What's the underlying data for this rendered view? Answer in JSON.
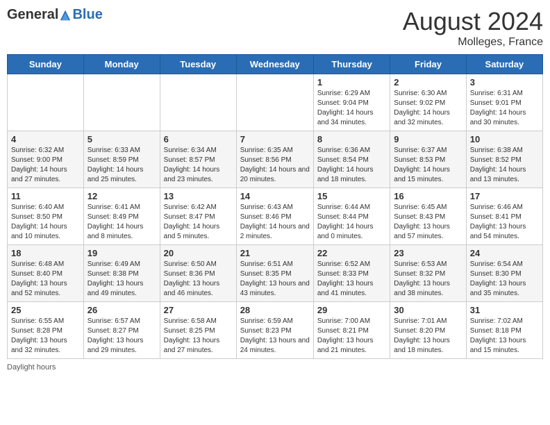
{
  "header": {
    "logo": {
      "general": "General",
      "blue": "Blue"
    },
    "title": "August 2024",
    "subtitle": "Molleges, France"
  },
  "days_of_week": [
    "Sunday",
    "Monday",
    "Tuesday",
    "Wednesday",
    "Thursday",
    "Friday",
    "Saturday"
  ],
  "weeks": [
    [
      {
        "day": "",
        "sunrise": "",
        "sunset": "",
        "daylight": ""
      },
      {
        "day": "",
        "sunrise": "",
        "sunset": "",
        "daylight": ""
      },
      {
        "day": "",
        "sunrise": "",
        "sunset": "",
        "daylight": ""
      },
      {
        "day": "",
        "sunrise": "",
        "sunset": "",
        "daylight": ""
      },
      {
        "day": "1",
        "sunrise": "Sunrise: 6:29 AM",
        "sunset": "Sunset: 9:04 PM",
        "daylight": "Daylight: 14 hours and 34 minutes."
      },
      {
        "day": "2",
        "sunrise": "Sunrise: 6:30 AM",
        "sunset": "Sunset: 9:02 PM",
        "daylight": "Daylight: 14 hours and 32 minutes."
      },
      {
        "day": "3",
        "sunrise": "Sunrise: 6:31 AM",
        "sunset": "Sunset: 9:01 PM",
        "daylight": "Daylight: 14 hours and 30 minutes."
      }
    ],
    [
      {
        "day": "4",
        "sunrise": "Sunrise: 6:32 AM",
        "sunset": "Sunset: 9:00 PM",
        "daylight": "Daylight: 14 hours and 27 minutes."
      },
      {
        "day": "5",
        "sunrise": "Sunrise: 6:33 AM",
        "sunset": "Sunset: 8:59 PM",
        "daylight": "Daylight: 14 hours and 25 minutes."
      },
      {
        "day": "6",
        "sunrise": "Sunrise: 6:34 AM",
        "sunset": "Sunset: 8:57 PM",
        "daylight": "Daylight: 14 hours and 23 minutes."
      },
      {
        "day": "7",
        "sunrise": "Sunrise: 6:35 AM",
        "sunset": "Sunset: 8:56 PM",
        "daylight": "Daylight: 14 hours and 20 minutes."
      },
      {
        "day": "8",
        "sunrise": "Sunrise: 6:36 AM",
        "sunset": "Sunset: 8:54 PM",
        "daylight": "Daylight: 14 hours and 18 minutes."
      },
      {
        "day": "9",
        "sunrise": "Sunrise: 6:37 AM",
        "sunset": "Sunset: 8:53 PM",
        "daylight": "Daylight: 14 hours and 15 minutes."
      },
      {
        "day": "10",
        "sunrise": "Sunrise: 6:38 AM",
        "sunset": "Sunset: 8:52 PM",
        "daylight": "Daylight: 14 hours and 13 minutes."
      }
    ],
    [
      {
        "day": "11",
        "sunrise": "Sunrise: 6:40 AM",
        "sunset": "Sunset: 8:50 PM",
        "daylight": "Daylight: 14 hours and 10 minutes."
      },
      {
        "day": "12",
        "sunrise": "Sunrise: 6:41 AM",
        "sunset": "Sunset: 8:49 PM",
        "daylight": "Daylight: 14 hours and 8 minutes."
      },
      {
        "day": "13",
        "sunrise": "Sunrise: 6:42 AM",
        "sunset": "Sunset: 8:47 PM",
        "daylight": "Daylight: 14 hours and 5 minutes."
      },
      {
        "day": "14",
        "sunrise": "Sunrise: 6:43 AM",
        "sunset": "Sunset: 8:46 PM",
        "daylight": "Daylight: 14 hours and 2 minutes."
      },
      {
        "day": "15",
        "sunrise": "Sunrise: 6:44 AM",
        "sunset": "Sunset: 8:44 PM",
        "daylight": "Daylight: 14 hours and 0 minutes."
      },
      {
        "day": "16",
        "sunrise": "Sunrise: 6:45 AM",
        "sunset": "Sunset: 8:43 PM",
        "daylight": "Daylight: 13 hours and 57 minutes."
      },
      {
        "day": "17",
        "sunrise": "Sunrise: 6:46 AM",
        "sunset": "Sunset: 8:41 PM",
        "daylight": "Daylight: 13 hours and 54 minutes."
      }
    ],
    [
      {
        "day": "18",
        "sunrise": "Sunrise: 6:48 AM",
        "sunset": "Sunset: 8:40 PM",
        "daylight": "Daylight: 13 hours and 52 minutes."
      },
      {
        "day": "19",
        "sunrise": "Sunrise: 6:49 AM",
        "sunset": "Sunset: 8:38 PM",
        "daylight": "Daylight: 13 hours and 49 minutes."
      },
      {
        "day": "20",
        "sunrise": "Sunrise: 6:50 AM",
        "sunset": "Sunset: 8:36 PM",
        "daylight": "Daylight: 13 hours and 46 minutes."
      },
      {
        "day": "21",
        "sunrise": "Sunrise: 6:51 AM",
        "sunset": "Sunset: 8:35 PM",
        "daylight": "Daylight: 13 hours and 43 minutes."
      },
      {
        "day": "22",
        "sunrise": "Sunrise: 6:52 AM",
        "sunset": "Sunset: 8:33 PM",
        "daylight": "Daylight: 13 hours and 41 minutes."
      },
      {
        "day": "23",
        "sunrise": "Sunrise: 6:53 AM",
        "sunset": "Sunset: 8:32 PM",
        "daylight": "Daylight: 13 hours and 38 minutes."
      },
      {
        "day": "24",
        "sunrise": "Sunrise: 6:54 AM",
        "sunset": "Sunset: 8:30 PM",
        "daylight": "Daylight: 13 hours and 35 minutes."
      }
    ],
    [
      {
        "day": "25",
        "sunrise": "Sunrise: 6:55 AM",
        "sunset": "Sunset: 8:28 PM",
        "daylight": "Daylight: 13 hours and 32 minutes."
      },
      {
        "day": "26",
        "sunrise": "Sunrise: 6:57 AM",
        "sunset": "Sunset: 8:27 PM",
        "daylight": "Daylight: 13 hours and 29 minutes."
      },
      {
        "day": "27",
        "sunrise": "Sunrise: 6:58 AM",
        "sunset": "Sunset: 8:25 PM",
        "daylight": "Daylight: 13 hours and 27 minutes."
      },
      {
        "day": "28",
        "sunrise": "Sunrise: 6:59 AM",
        "sunset": "Sunset: 8:23 PM",
        "daylight": "Daylight: 13 hours and 24 minutes."
      },
      {
        "day": "29",
        "sunrise": "Sunrise: 7:00 AM",
        "sunset": "Sunset: 8:21 PM",
        "daylight": "Daylight: 13 hours and 21 minutes."
      },
      {
        "day": "30",
        "sunrise": "Sunrise: 7:01 AM",
        "sunset": "Sunset: 8:20 PM",
        "daylight": "Daylight: 13 hours and 18 minutes."
      },
      {
        "day": "31",
        "sunrise": "Sunrise: 7:02 AM",
        "sunset": "Sunset: 8:18 PM",
        "daylight": "Daylight: 13 hours and 15 minutes."
      }
    ]
  ],
  "footer": {
    "daylight_label": "Daylight hours"
  }
}
